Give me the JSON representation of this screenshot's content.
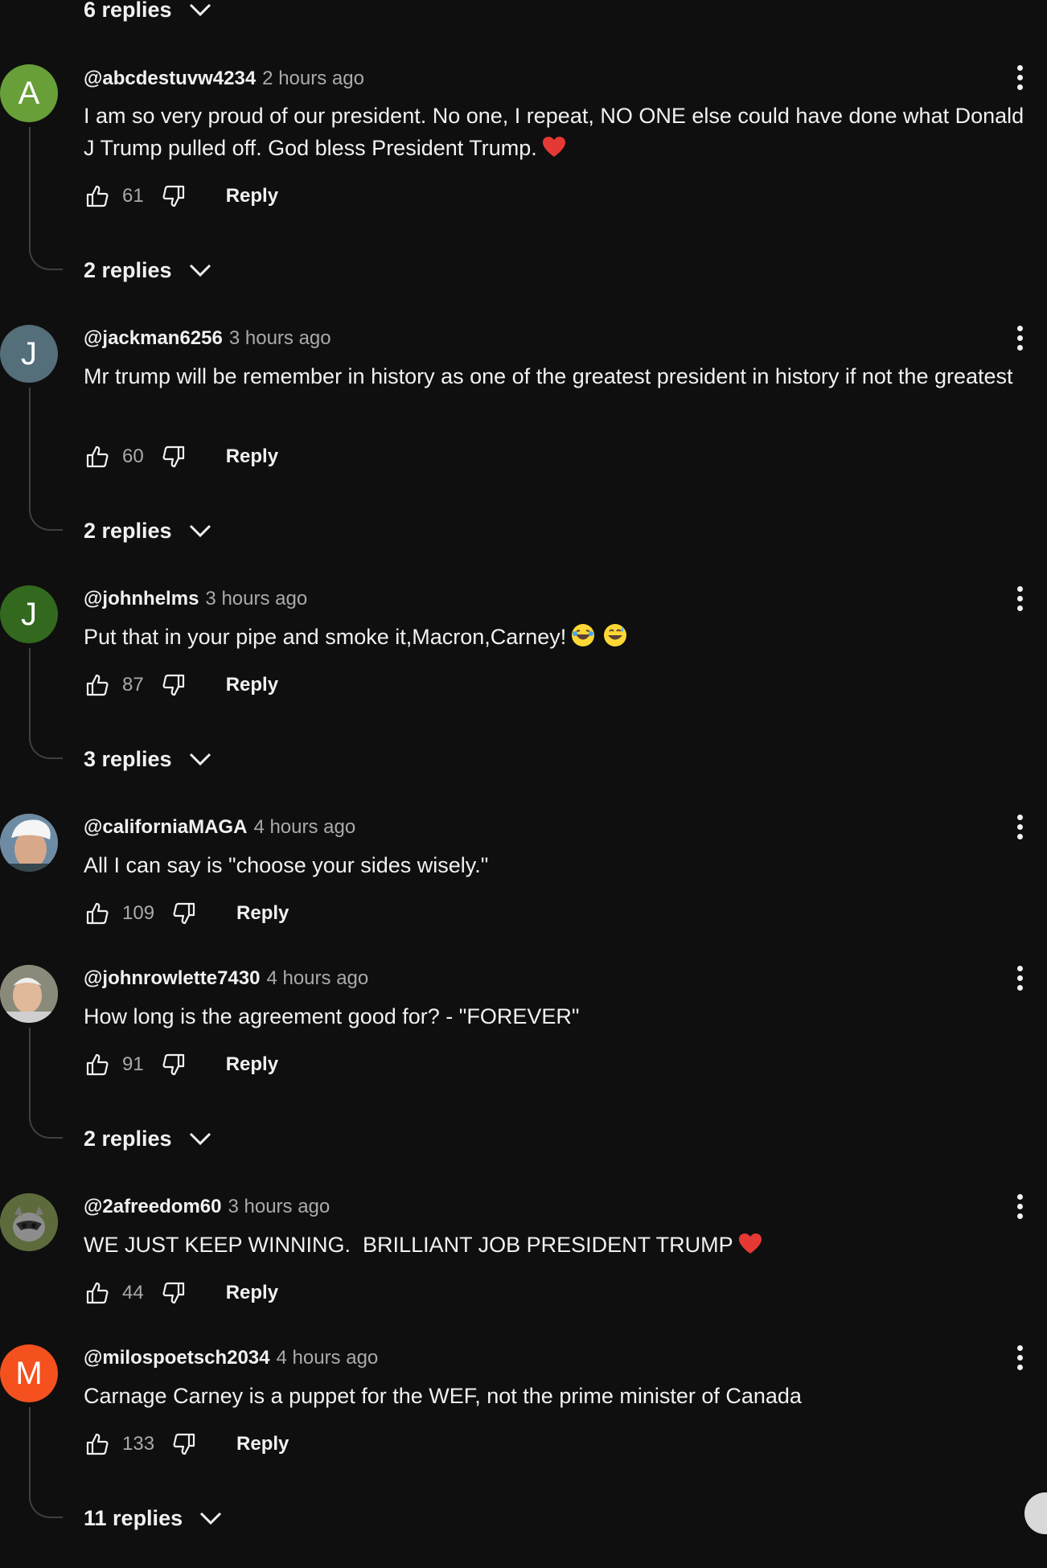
{
  "top_replies": {
    "label": "6 replies"
  },
  "comments": [
    {
      "avatar_letter": "A",
      "avatar_color": "#689f38",
      "author": "@abcdestuvw4234",
      "time": "2 hours ago",
      "text": "I am so very proud of our president. No one, I repeat, NO ONE else could have done what Donald J Trump pulled off. God bless President Trump.",
      "emoji": "red-heart",
      "likes": "61",
      "reply_label": "Reply",
      "replies_label": "2 replies"
    },
    {
      "avatar_letter": "J",
      "avatar_color": "#546e7a",
      "author": "@jackman6256",
      "time": "3 hours ago",
      "text": "Mr trump will be remember in history as one of the greatest president in history if not the greatest",
      "likes": "60",
      "reply_label": "Reply",
      "replies_label": "2 replies"
    },
    {
      "avatar_letter": "J",
      "avatar_color": "#33691e",
      "author": "@johnhelms",
      "time": "3 hours ago",
      "text": "Put that in your pipe and smoke it,Macron,Carney!",
      "emoji": "laughing-faces",
      "likes": "87",
      "reply_label": "Reply",
      "replies_label": "3 replies"
    },
    {
      "avatar_letter": "",
      "avatar_color": "#8d6e63",
      "author": "@californiaMAGA",
      "time": "4 hours ago",
      "text": "All I can say is \"choose your sides wisely.\"",
      "likes": "109",
      "reply_label": "Reply"
    },
    {
      "avatar_letter": "",
      "avatar_color": "#9e9e9e",
      "author": "@johnrowlette7430",
      "time": "4 hours ago",
      "text": "How long is the agreement good for? - \"FOREVER\"",
      "likes": "91",
      "reply_label": "Reply",
      "replies_label": "2 replies"
    },
    {
      "avatar_letter": "",
      "avatar_color": "#5d6b3c",
      "author": "@2afreedom60",
      "time": "3 hours ago",
      "text": "WE JUST KEEP WINNING.  BRILLIANT JOB PRESIDENT TRUMP",
      "emoji": "red-heart",
      "likes": "44",
      "reply_label": "Reply"
    },
    {
      "avatar_letter": "M",
      "avatar_color": "#f4511e",
      "author": "@milospoetsch2034",
      "time": "4 hours ago",
      "text": "Carnage Carney is a puppet for the WEF, not the prime minister of Canada",
      "likes": "133",
      "reply_label": "Reply",
      "replies_label": "11 replies"
    }
  ],
  "colors": {
    "background": "#0f0f0f",
    "text": "#f1f1f1",
    "secondary_text": "#aaaaaa",
    "thread_line": "#3f3f3f"
  }
}
